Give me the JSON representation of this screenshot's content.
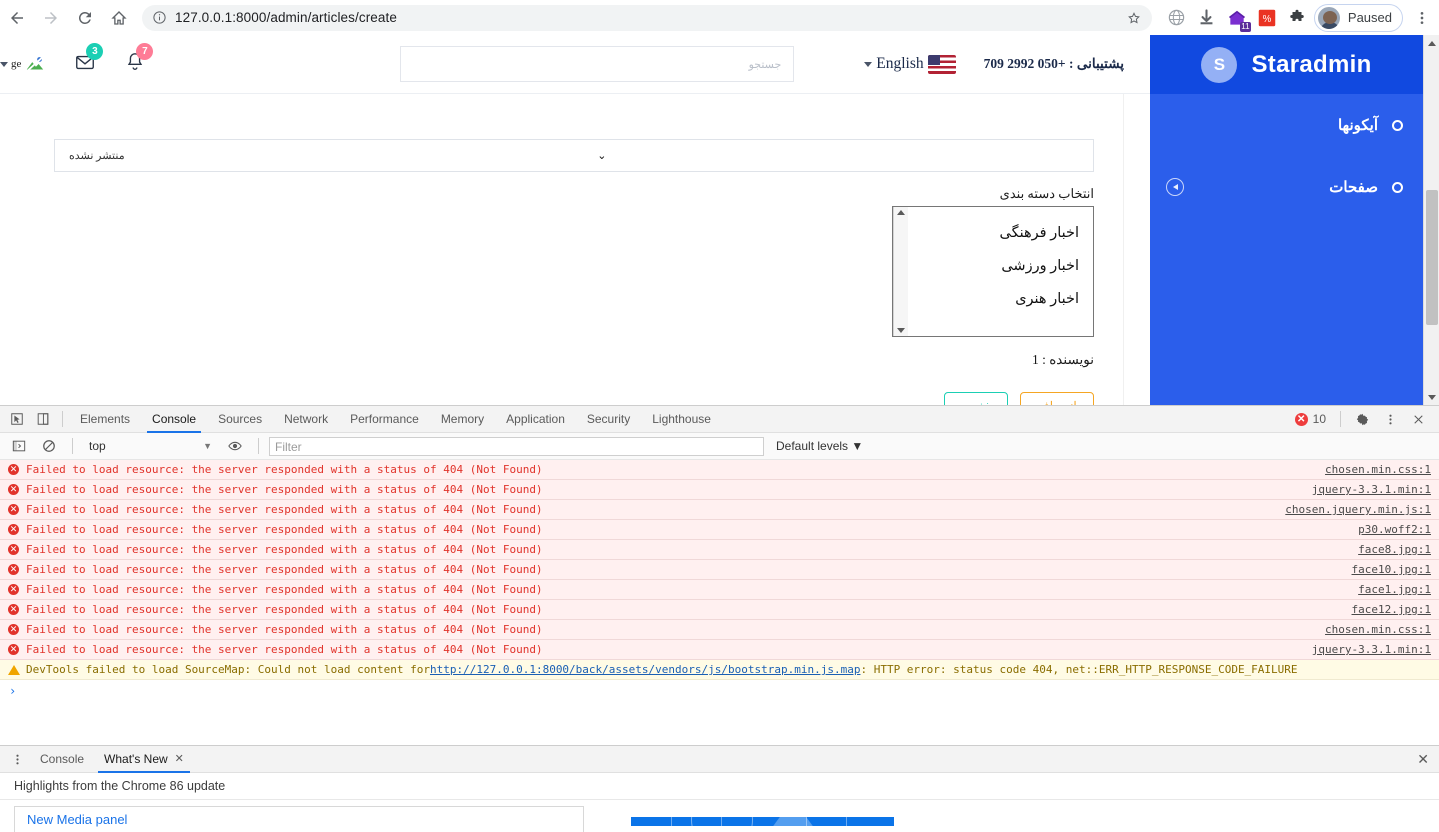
{
  "browser": {
    "url": "127.0.0.1:8000/admin/articles/create",
    "back_icon": "back-arrow-icon",
    "forward_icon": "forward-arrow-icon",
    "reload_icon": "reload-icon",
    "home_icon": "home-icon",
    "info_icon": "page-info-icon",
    "star_icon": "bookmark-star-icon",
    "extensions": [
      {
        "name": "globe-icon"
      },
      {
        "name": "download-icon"
      },
      {
        "name": "extension-purple-icon",
        "badge": "11"
      },
      {
        "name": "red-app-icon"
      },
      {
        "name": "puzzle-icon"
      }
    ],
    "profile_label": "Paused",
    "menu_icon": "three-dot-menu-icon"
  },
  "sidebar": {
    "brand_initial": "S",
    "brand_name": "Staradmin",
    "items": [
      {
        "label": "آیکونها",
        "has_arrow": false
      },
      {
        "label": "صفحات",
        "has_arrow": true
      }
    ]
  },
  "navbar": {
    "support_text": "پشتیبانی : +050 2992 709",
    "language": "English",
    "flag": "us-flag-icon",
    "search_placeholder": "جستجو",
    "search_value": "",
    "messages_count": "3",
    "notifications_count": "7",
    "profile_alt": "ge"
  },
  "form": {
    "status_value": "منتشر نشده",
    "category_label": "انتخاب دسته بندی",
    "categories": [
      "اخبار فرهنگی",
      "اخبار ورزشی",
      "اخبار هنری"
    ],
    "author_text": "نویسنده : 1",
    "save_label": "ذخیره",
    "cancel_label": "انصراف"
  },
  "devtools": {
    "tabs": [
      "Elements",
      "Console",
      "Sources",
      "Network",
      "Performance",
      "Memory",
      "Application",
      "Security",
      "Lighthouse"
    ],
    "active_tab": "Console",
    "error_count": "10",
    "inspect_icon": "inspect-element-icon",
    "device_icon": "device-toolbar-icon",
    "settings_icon": "settings-gear-icon",
    "more_icon": "more-options-icon",
    "close_icon": "close-devtools-icon",
    "console": {
      "context": "top",
      "filter_placeholder": "Filter",
      "filter_value": "",
      "levels_label": "Default levels",
      "live_expression_icon": "eye-icon",
      "clear_icon": "clear-console-icon",
      "sidebar_icon": "console-sidebar-icon",
      "prompt": "›",
      "messages": [
        {
          "type": "error",
          "text": "Failed to load resource: the server responded with a status of 404 (Not Found)",
          "source": "chosen.min.css:1"
        },
        {
          "type": "error",
          "text": "Failed to load resource: the server responded with a status of 404 (Not Found)",
          "source": "jquery-3.3.1.min:1"
        },
        {
          "type": "error",
          "text": "Failed to load resource: the server responded with a status of 404 (Not Found)",
          "source": "chosen.jquery.min.js:1"
        },
        {
          "type": "error",
          "text": "Failed to load resource: the server responded with a status of 404 (Not Found)",
          "source": "p30.woff2:1"
        },
        {
          "type": "error",
          "text": "Failed to load resource: the server responded with a status of 404 (Not Found)",
          "source": "face8.jpg:1"
        },
        {
          "type": "error",
          "text": "Failed to load resource: the server responded with a status of 404 (Not Found)",
          "source": "face10.jpg:1"
        },
        {
          "type": "error",
          "text": "Failed to load resource: the server responded with a status of 404 (Not Found)",
          "source": "face1.jpg:1"
        },
        {
          "type": "error",
          "text": "Failed to load resource: the server responded with a status of 404 (Not Found)",
          "source": "face12.jpg:1"
        },
        {
          "type": "error",
          "text": "Failed to load resource: the server responded with a status of 404 (Not Found)",
          "source": "chosen.min.css:1"
        },
        {
          "type": "error",
          "text": "Failed to load resource: the server responded with a status of 404 (Not Found)",
          "source": "jquery-3.3.1.min:1"
        }
      ],
      "warning": {
        "prefix": "DevTools failed to load SourceMap: Could not load content for ",
        "link": "http://127.0.0.1:8000/back/assets/vendors/js/bootstrap.min.js.map",
        "suffix": ": HTTP error: status code 404, net::ERR_HTTP_RESPONSE_CODE_FAILURE"
      }
    }
  },
  "drawer": {
    "tabs": [
      {
        "label": "Console",
        "closable": false,
        "active": false
      },
      {
        "label": "What's New",
        "closable": true,
        "active": true
      }
    ],
    "subtitle": "Highlights from the Chrome 86 update",
    "card_title": "New Media panel",
    "menu_icon": "drawer-menu-icon",
    "close_icon": "drawer-close-icon"
  },
  "colors": {
    "sidebar_bg": "#2b5eeb",
    "sidebar_brand_bg": "#1149e0",
    "accent_blue": "#1a73e8",
    "error_red": "#e1332b",
    "warn_yellow": "#fffbe5",
    "save_green": "#1bcfb4",
    "cancel_orange": "#f5a623"
  }
}
